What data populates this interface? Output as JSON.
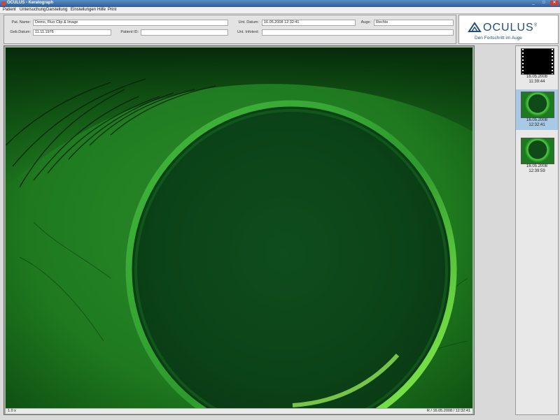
{
  "window": {
    "title": "OCULUS - Keratograph"
  },
  "window_controls": [
    "_",
    "□",
    "✕"
  ],
  "menu": [
    "Patient",
    "Untersuchung",
    "Darstellung",
    "Einstellungen",
    "Hilfe",
    "Print"
  ],
  "patient": {
    "name_label": "Pat. Name:",
    "name_value": "Demo, Fluo Clip & Image",
    "dob_label": "Geb.Datum:",
    "dob_value": "11.11.1976",
    "id_label": "Patient ID:",
    "id_value": ""
  },
  "exam": {
    "date_label": "Unt. Datum:",
    "date_value": "16.05.2008 12:32:41",
    "eye_label": "Auge:",
    "eye_value": "Rechts",
    "info_label": "Unt. Infotext:",
    "info_value": ""
  },
  "logo": {
    "brand": "OCULUS",
    "registered": "®",
    "slogan": "Den Fortschritt im Auge"
  },
  "image": {
    "zoom": "1.0 x",
    "status": "R / 16.05.2008 / 12:32:41"
  },
  "thumbnails": [
    {
      "date": "16.05.2008",
      "time": "11:39:44",
      "kind": "video",
      "selected": false
    },
    {
      "date": "16.05.2008",
      "time": "12:32:41",
      "kind": "image",
      "selected": true
    },
    {
      "date": "16.05.2008",
      "time": "12:39:59",
      "kind": "image",
      "selected": false
    }
  ],
  "colors": {
    "accent": "#1f4f7a",
    "fluo_green": "#27a82a",
    "selection": "#a7c9e6"
  }
}
